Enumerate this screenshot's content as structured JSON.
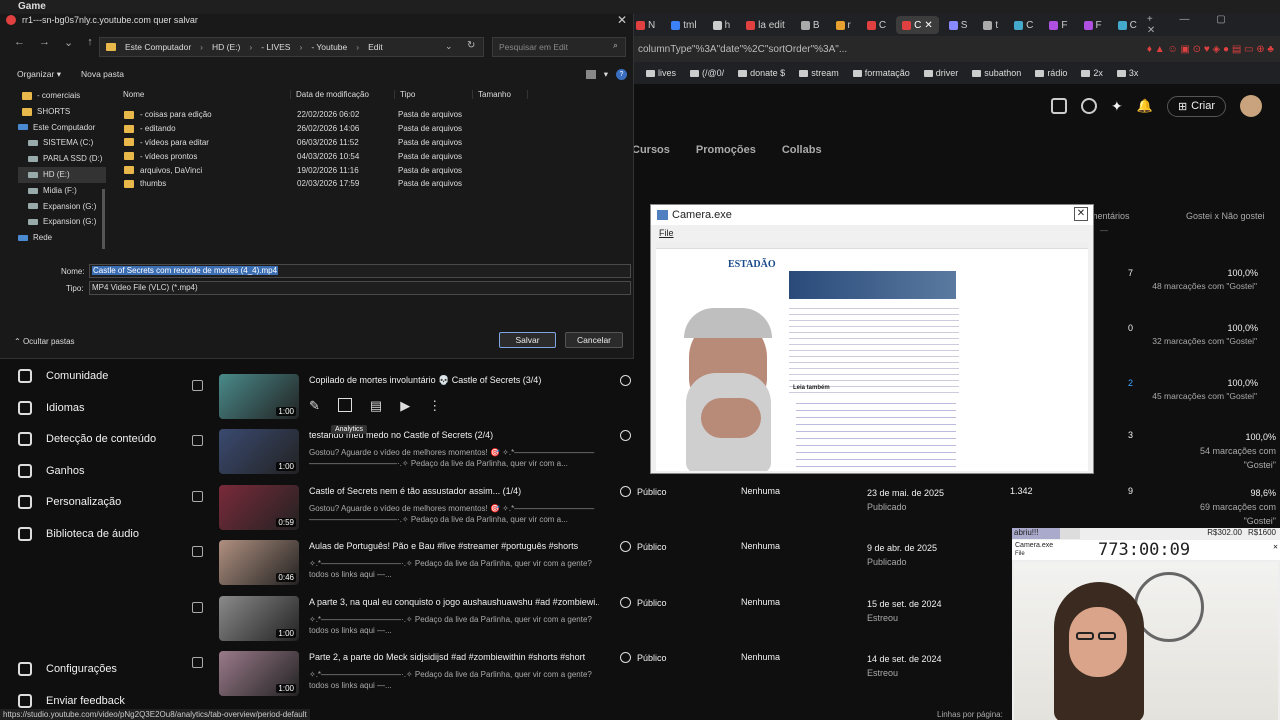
{
  "browser": {
    "title": "Game",
    "tabs": [
      {
        "label": "N",
        "color": "#e04040",
        "active": false
      },
      {
        "label": "tml",
        "color": "#3b82f6",
        "active": false
      },
      {
        "label": "h",
        "color": "#ccc",
        "active": false
      },
      {
        "label": "la edit",
        "color": "#e04040",
        "active": false
      },
      {
        "label": "B",
        "color": "#aaa",
        "active": false
      },
      {
        "label": "r",
        "color": "#e8a030",
        "active": false
      },
      {
        "label": "C",
        "color": "#e04040",
        "active": false
      },
      {
        "label": "C",
        "color": "#e04040",
        "active": true
      },
      {
        "label": "S",
        "color": "#88f",
        "active": false
      },
      {
        "label": "t",
        "color": "#aaa",
        "active": false
      },
      {
        "label": "C",
        "color": "#4ac",
        "active": false
      },
      {
        "label": "F",
        "color": "#b050e0",
        "active": false
      },
      {
        "label": "F",
        "color": "#b050e0",
        "active": false
      },
      {
        "label": "C",
        "color": "#4ac",
        "active": false
      }
    ],
    "url": "columnType\"%3A\"date\"%2C\"sortOrder\"%3A\"...",
    "bookmarks": [
      "lives",
      "(/@0/",
      "donate $",
      "stream",
      "formatação",
      "driver",
      "subathon",
      "rádio",
      "2x",
      "3x"
    ],
    "status_url": "https://studio.youtube.com/video/pNg2Q3E2Ou8/analytics/tab-overview/period-default"
  },
  "studio": {
    "create_label": "Criar",
    "tabs": [
      "Cursos",
      "Promoções",
      "Collabs"
    ],
    "headers": {
      "comments": "mentários",
      "likes": "Gostei x Não gostei"
    },
    "sidebar": [
      {
        "label": "Comunidade",
        "icon": "community-icon"
      },
      {
        "label": "Idiomas",
        "icon": "languages-icon"
      },
      {
        "label": "Detecção de conteúdo",
        "icon": "content-detection-icon"
      },
      {
        "label": "Ganhos",
        "icon": "earnings-icon"
      },
      {
        "label": "Personalização",
        "icon": "customization-icon"
      },
      {
        "label": "Biblioteca de áudio",
        "icon": "audio-library-icon"
      },
      {
        "label": "Configurações",
        "icon": "settings-icon"
      },
      {
        "label": "Enviar feedback",
        "icon": "feedback-icon"
      }
    ],
    "hover_tooltip": "Analytics",
    "upper_rows": [
      {
        "comments": "7",
        "likes": "100,0%",
        "likes_sub": "48 marcações com \"Gostei\""
      },
      {
        "comments": "0",
        "likes": "100,0%",
        "likes_sub": "32 marcações com \"Gostei\""
      },
      {
        "comments": "2",
        "likes": "100,0%",
        "likes_sub": "45 marcações com \"Gostei\""
      }
    ],
    "videos": [
      {
        "title": "Copilado de mortes involuntário 💀 Castle of Secrets (3/4)",
        "desc": "",
        "duration": "1:00",
        "visibility": "",
        "restrictions": "",
        "date": "",
        "date_sub": "",
        "views": "",
        "comments": "",
        "likes": "",
        "likes_sub": "",
        "thumb": "#4a8a8a"
      },
      {
        "title": "testando meu medo no Castle of Secrets (2/4)",
        "desc": "Gostou? Aguarde o vídeo de melhores momentos! 🎯 ✧.*—————————— ———————————·.✧ Pedaço da live da Parlinha, quer vir com a...",
        "duration": "1:00",
        "visibility": "",
        "restrictions": "",
        "date": "",
        "date_sub": "",
        "views": "",
        "comments": "3",
        "likes": "100,0%",
        "likes_sub": "54 marcações com \"Gostei\"",
        "thumb": "#3a4a70"
      },
      {
        "title": "Castle of Secrets nem é tão assustador assim... (1/4)",
        "desc": "Gostou? Aguarde o vídeo de melhores momentos! 🎯 ✧.*—————————— ———————————·.✧ Pedaço da live da Parlinha, quer vir com a...",
        "duration": "0:59",
        "visibility": "Público",
        "restrictions": "Nenhuma",
        "date": "23 de mai. de 2025",
        "date_sub": "Publicado",
        "views": "1.342",
        "comments": "9",
        "likes": "98,6%",
        "likes_sub": "69 marcações com \"Gostei\"",
        "thumb": "#7a2a3a"
      },
      {
        "title": "Aulas de Português! Pão e Bau #live #streamer #português #shorts",
        "desc": "✧.*——————————·.✧ Pedaço da live da Parlinha, quer vir com a gente? todos os links aqui —...",
        "duration": "0:46",
        "visibility": "Público",
        "restrictions": "Nenhuma",
        "date": "9 de abr. de 2025",
        "date_sub": "Publicado",
        "views": "",
        "comments": "",
        "likes": "",
        "likes_sub": "",
        "thumb": "#b09080"
      },
      {
        "title": "A parte 3, na qual eu conquisto o jogo aushaushuawshu #ad #zombiewi...",
        "desc": "✧.*——————————·.✧ Pedaço da live da Parlinha, quer vir com a gente? todos os links aqui —...",
        "duration": "1:00",
        "visibility": "Público",
        "restrictions": "Nenhuma",
        "date": "15 de set. de 2024",
        "date_sub": "Estreou",
        "views": "",
        "comments": "",
        "likes": "",
        "likes_sub": "",
        "thumb": "#8a8a8a"
      },
      {
        "title": "Parte 2, a parte do Meck sidjsidijsd #ad #zombiewithin #shorts #short",
        "desc": "✧.*——————————·.✧ Pedaço da live da Parlinha, quer vir com a gente? todos os links aqui —...",
        "duration": "1:00",
        "visibility": "Público",
        "restrictions": "Nenhuma",
        "date": "14 de set. de 2024",
        "date_sub": "Estreou",
        "views": "",
        "comments": "",
        "likes": "",
        "likes_sub": "",
        "thumb": "#9a7a8a"
      }
    ],
    "footer": "Linhas por página:"
  },
  "dialog": {
    "title": "rr1---sn-bg0s7nly.c.youtube.com quer salvar",
    "path": [
      "Este Computador",
      "HD (E:)",
      "- LIVES",
      "- Youtube",
      "Edit"
    ],
    "search_placeholder": "Pesquisar em Edit",
    "organize": "Organizar",
    "new_folder": "Nova pasta",
    "tree": [
      {
        "label": "- comerciais",
        "kind": "folder"
      },
      {
        "label": "SHORTS",
        "kind": "folder"
      },
      {
        "label": "Este Computador",
        "kind": "pc"
      },
      {
        "label": "SISTEMA (C:)",
        "kind": "drive"
      },
      {
        "label": "PARLA SSD (D:)",
        "kind": "drive"
      },
      {
        "label": "HD (E:)",
        "kind": "drive"
      },
      {
        "label": "Midia (F:)",
        "kind": "drive"
      },
      {
        "label": "Expansion (G:)",
        "kind": "drive"
      },
      {
        "label": "Expansion (G:)",
        "kind": "drive"
      },
      {
        "label": "Rede",
        "kind": "network"
      }
    ],
    "columns": [
      "Nome",
      "Data de modificação",
      "Tipo",
      "Tamanho"
    ],
    "files": [
      {
        "name": "- coisas para edição",
        "date": "22/02/2026 06:02",
        "type": "Pasta de arquivos"
      },
      {
        "name": "- editando",
        "date": "26/02/2026 14:06",
        "type": "Pasta de arquivos"
      },
      {
        "name": "- vídeos para editar",
        "date": "06/03/2026 11:52",
        "type": "Pasta de arquivos"
      },
      {
        "name": "- vídeos prontos",
        "date": "04/03/2026 10:54",
        "type": "Pasta de arquivos"
      },
      {
        "name": "arquivos, DaVinci",
        "date": "19/02/2026 11:16",
        "type": "Pasta de arquivos"
      },
      {
        "name": "thumbs",
        "date": "02/03/2026 17:59",
        "type": "Pasta de arquivos"
      }
    ],
    "name_label": "Nome:",
    "name_value": "Castle of Secrets com recorde de mortes (4_4).mp4",
    "type_label": "Tipo:",
    "type_value": "MP4 Video File (VLC) (*.mp4)",
    "hide_folders": "Ocultar pastas",
    "save": "Salvar",
    "cancel": "Cancelar"
  },
  "camera": {
    "title": "Camera.exe",
    "menu": "File",
    "page_logo": "ESTADÃO",
    "page_heading": "Leia também"
  },
  "small_cam": {
    "left_label": "abriu!!!",
    "mid_label": "R$302.00",
    "right_label": "R$1600",
    "title": "Camera.exe",
    "menu": "File",
    "timer": "773:00:09"
  },
  "colors": {
    "accent": "#3ea6ff",
    "link_blue": "#3c6eb4"
  }
}
